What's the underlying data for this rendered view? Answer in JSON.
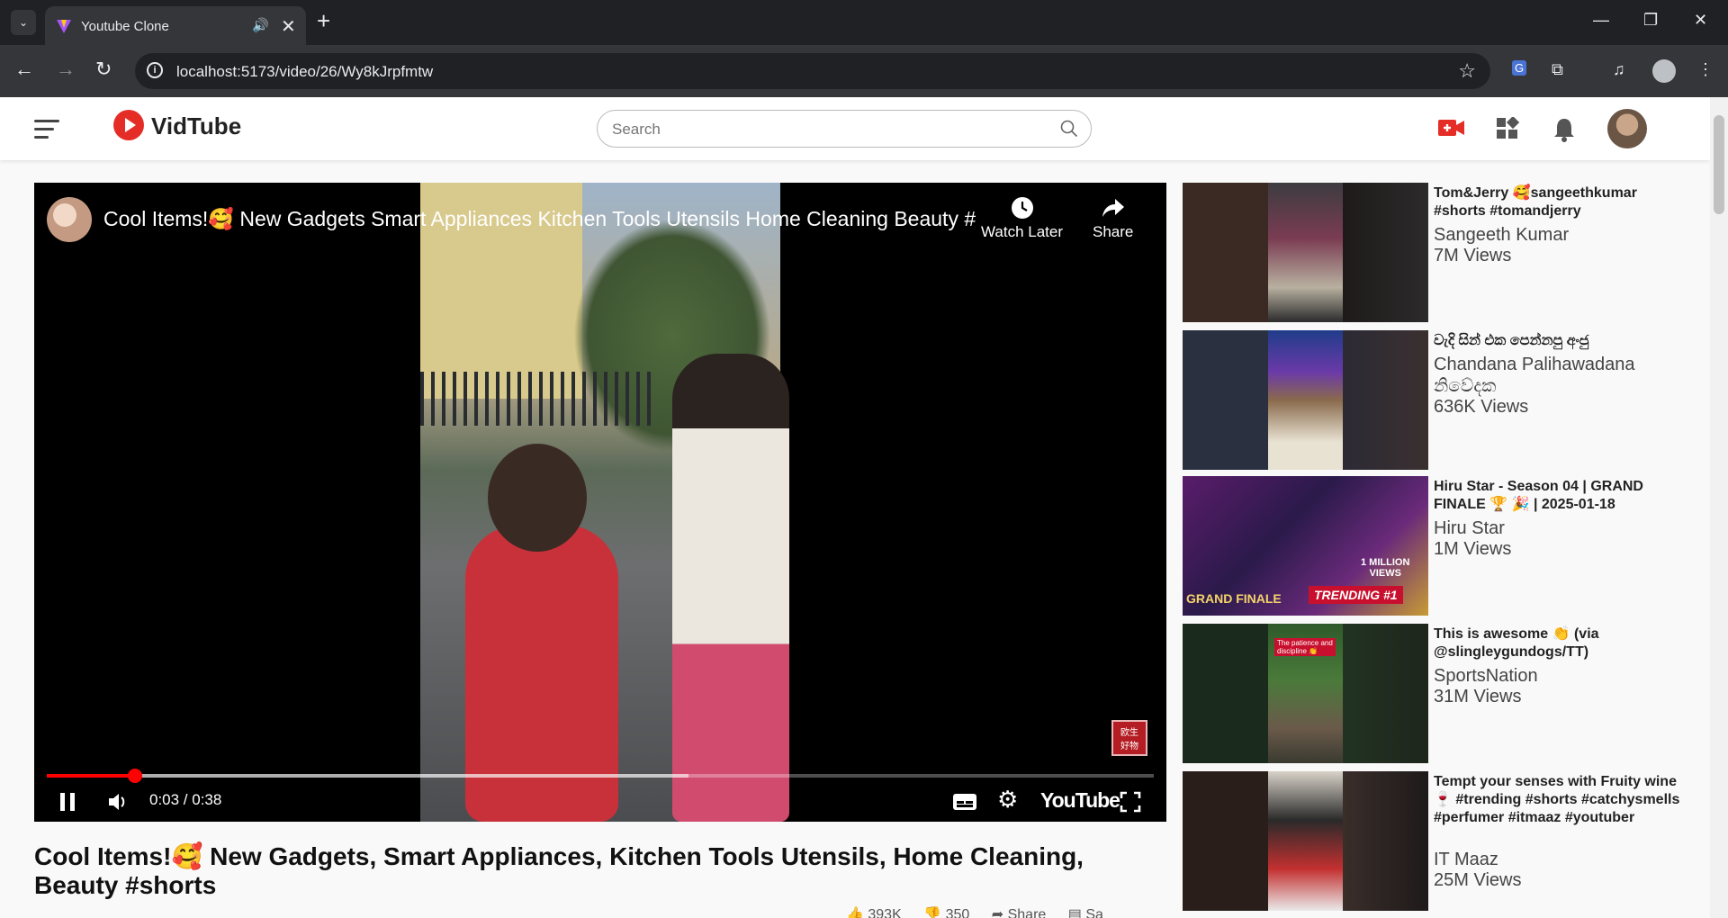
{
  "browser": {
    "tab_title": "Youtube Clone",
    "url": "localhost:5173/video/26/Wy8kJrpfmtw"
  },
  "header": {
    "logo_text": "VidTube",
    "search_placeholder": "Search"
  },
  "player": {
    "title": "Cool Items!🥰 New Gadgets Smart Appliances Kitchen Tools Utensils Home Cleaning Beauty #...",
    "watch_later_label": "Watch Later",
    "share_label": "Share",
    "time_display": "0:03 / 0:38",
    "played_fraction": 0.08,
    "buffered_fraction": 0.58,
    "logo_word": "YouTube"
  },
  "video": {
    "title": "Cool Items!🥰 New Gadgets, Smart Appliances, Kitchen Tools Utensils, Home Cleaning, Beauty #shorts",
    "likes": "393K",
    "dislikes": "350",
    "share_label": "Share",
    "save_label": "Sa"
  },
  "recommendations": [
    {
      "title": "Tom&Jerry 🥰sangeethkumar #shorts #tomandjerry",
      "channel": "Sangeeth Kumar",
      "views": "7M Views"
    },
    {
      "title": "වැදි සින් එක පෙන්නපු අංජු",
      "channel": "Chandana Palihawadana නිවේදක",
      "views": "636K Views"
    },
    {
      "title": "Hiru Star - Season 04 | GRAND FINALE 🏆 🎉 | 2025-01-18",
      "channel": "Hiru Star",
      "views": "1M Views"
    },
    {
      "title": "This is awesome 👏 (via @slingleygundogs/TT)",
      "channel": "SportsNation",
      "views": "31M Views"
    },
    {
      "title": "Tempt your senses with Fruity wine 🍷 #trending #shorts #catchysmells #perfumer #itmaaz #youtuber",
      "channel": "IT Maaz",
      "views": "25M Views"
    }
  ]
}
